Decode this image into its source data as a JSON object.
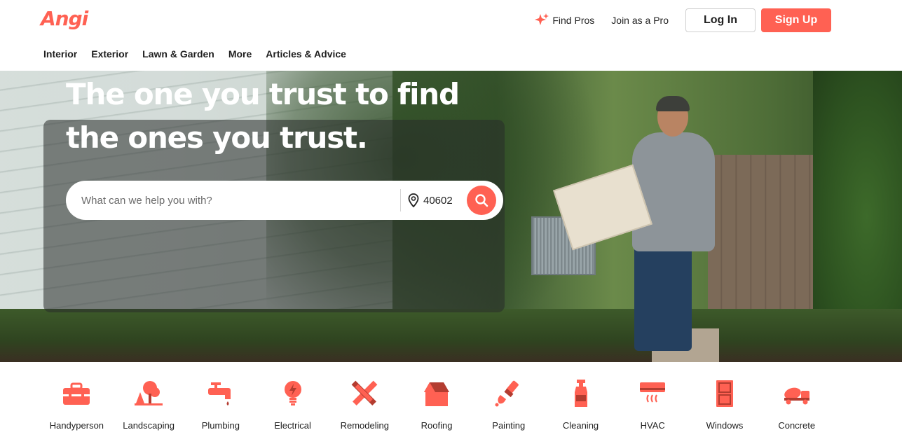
{
  "brand": {
    "logo_text": "Angi",
    "accent": "#ff6153"
  },
  "header": {
    "find_pros": "Find Pros",
    "join_pro": "Join as a Pro",
    "login": "Log In",
    "signup": "Sign Up"
  },
  "nav": {
    "items": [
      "Interior",
      "Exterior",
      "Lawn & Garden",
      "More",
      "Articles & Advice"
    ]
  },
  "hero": {
    "title": "The one you trust to find the ones you trust.",
    "search_placeholder": "What can we help you with?",
    "zip_value": "40602"
  },
  "categories": [
    {
      "label": "Handyperson",
      "icon": "toolbox-icon"
    },
    {
      "label": "Landscaping",
      "icon": "tree-icon"
    },
    {
      "label": "Plumbing",
      "icon": "faucet-icon"
    },
    {
      "label": "Electrical",
      "icon": "lightbulb-icon"
    },
    {
      "label": "Remodeling",
      "icon": "ruler-pencil-icon"
    },
    {
      "label": "Roofing",
      "icon": "house-roof-icon"
    },
    {
      "label": "Painting",
      "icon": "paintbrush-icon"
    },
    {
      "label": "Cleaning",
      "icon": "spray-bottle-icon"
    },
    {
      "label": "HVAC",
      "icon": "air-conditioner-icon"
    },
    {
      "label": "Windows",
      "icon": "window-icon"
    },
    {
      "label": "Concrete",
      "icon": "cement-truck-icon"
    }
  ]
}
